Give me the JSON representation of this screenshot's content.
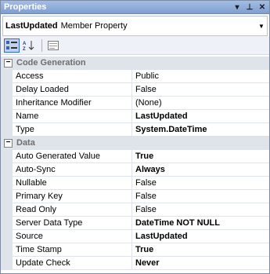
{
  "window": {
    "title": "Properties"
  },
  "title_buttons": {
    "dropdown": "▾",
    "pin": "⊥",
    "close": "✕"
  },
  "object_selector": {
    "name": "LastUpdated",
    "type": "Member Property"
  },
  "categories": [
    {
      "label": "Code Generation",
      "toggle": "−",
      "rows": [
        {
          "name": "Access",
          "value": "Public",
          "bold": false
        },
        {
          "name": "Delay Loaded",
          "value": "False",
          "bold": false
        },
        {
          "name": "Inheritance Modifier",
          "value": "(None)",
          "bold": false
        },
        {
          "name": "Name",
          "value": "LastUpdated",
          "bold": true
        },
        {
          "name": "Type",
          "value": "System.DateTime",
          "bold": true
        }
      ]
    },
    {
      "label": "Data",
      "toggle": "−",
      "rows": [
        {
          "name": "Auto Generated Value",
          "value": "True",
          "bold": true
        },
        {
          "name": "Auto-Sync",
          "value": "Always",
          "bold": true
        },
        {
          "name": "Nullable",
          "value": "False",
          "bold": false
        },
        {
          "name": "Primary Key",
          "value": "False",
          "bold": false
        },
        {
          "name": "Read Only",
          "value": "False",
          "bold": false
        },
        {
          "name": "Server Data Type",
          "value": "DateTime NOT NULL",
          "bold": true
        },
        {
          "name": "Source",
          "value": "LastUpdated",
          "bold": true
        },
        {
          "name": "Time Stamp",
          "value": "True",
          "bold": true
        },
        {
          "name": "Update Check",
          "value": "Never",
          "bold": true
        }
      ]
    }
  ]
}
